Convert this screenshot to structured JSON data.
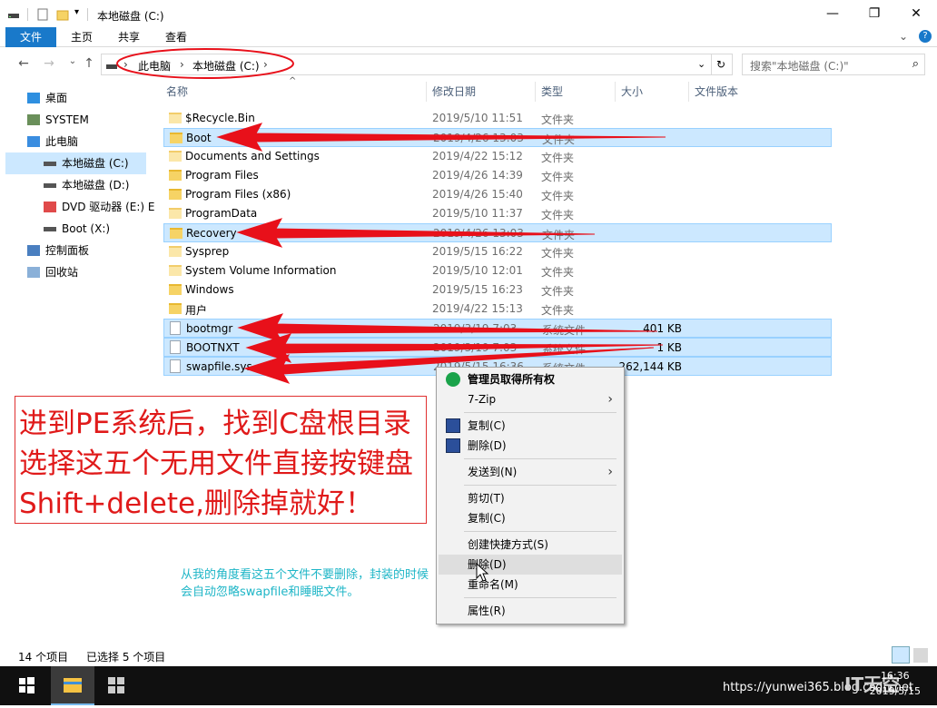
{
  "window": {
    "title": "本地磁盘 (C:)",
    "controls": {
      "minimize": "—",
      "maximize": "❐",
      "close": "✕"
    }
  },
  "ribbon": {
    "tabs": [
      "文件",
      "主页",
      "共享",
      "查看"
    ]
  },
  "address": {
    "path": [
      "此电脑",
      "本地磁盘 (C:)"
    ],
    "search_placeholder": "搜索\"本地磁盘 (C:)\""
  },
  "nav": {
    "items": [
      {
        "label": "桌面",
        "icon": "desktop-icon"
      },
      {
        "label": "SYSTEM",
        "icon": "user-icon"
      },
      {
        "label": "此电脑",
        "icon": "computer-icon"
      },
      {
        "label": "本地磁盘 (C:)",
        "icon": "drive-icon",
        "selected": true
      },
      {
        "label": "本地磁盘 (D:)",
        "icon": "drive-icon"
      },
      {
        "label": "DVD 驱动器 (E:) E",
        "icon": "dvd-icon"
      },
      {
        "label": "Boot (X:)",
        "icon": "drive-icon"
      },
      {
        "label": "控制面板",
        "icon": "control-panel-icon"
      },
      {
        "label": "回收站",
        "icon": "recycle-bin-icon"
      }
    ]
  },
  "columns": {
    "name": "名称",
    "date": "修改日期",
    "type": "类型",
    "size": "大小",
    "version": "文件版本"
  },
  "files": [
    {
      "name": "$Recycle.Bin",
      "date": "2019/5/10 11:51",
      "type": "文件夹",
      "size": "",
      "kind": "folder-light",
      "selected": false
    },
    {
      "name": "Boot",
      "date": "2019/4/26 13:03",
      "type": "文件夹",
      "size": "",
      "kind": "folder",
      "selected": true
    },
    {
      "name": "Documents and Settings",
      "date": "2019/4/22 15:12",
      "type": "文件夹",
      "size": "",
      "kind": "folder-light",
      "selected": false
    },
    {
      "name": "Program Files",
      "date": "2019/4/26 14:39",
      "type": "文件夹",
      "size": "",
      "kind": "folder",
      "selected": false
    },
    {
      "name": "Program Files (x86)",
      "date": "2019/4/26 15:40",
      "type": "文件夹",
      "size": "",
      "kind": "folder",
      "selected": false
    },
    {
      "name": "ProgramData",
      "date": "2019/5/10 11:37",
      "type": "文件夹",
      "size": "",
      "kind": "folder-light",
      "selected": false
    },
    {
      "name": "Recovery",
      "date": "2019/4/26 13:03",
      "type": "文件夹",
      "size": "",
      "kind": "folder",
      "selected": true
    },
    {
      "name": "Sysprep",
      "date": "2019/5/15 16:22",
      "type": "文件夹",
      "size": "",
      "kind": "folder-light",
      "selected": false
    },
    {
      "name": "System Volume Information",
      "date": "2019/5/10 12:01",
      "type": "文件夹",
      "size": "",
      "kind": "folder-light",
      "selected": false
    },
    {
      "name": "Windows",
      "date": "2019/5/15 16:23",
      "type": "文件夹",
      "size": "",
      "kind": "folder",
      "selected": false
    },
    {
      "name": "用户",
      "date": "2019/4/22 15:13",
      "type": "文件夹",
      "size": "",
      "kind": "folder",
      "selected": false
    },
    {
      "name": "bootmgr",
      "date": "2019/3/19 7:03",
      "type": "系统文件",
      "size": "401 KB",
      "kind": "file",
      "selected": true
    },
    {
      "name": "BOOTNXT",
      "date": "2019/3/19 7:03",
      "type": "系统文件",
      "size": "1 KB",
      "kind": "file",
      "selected": true
    },
    {
      "name": "swapfile.sys",
      "date": "2019/5/15 16:36",
      "type": "系统文件",
      "size": "262,144 KB",
      "kind": "file",
      "selected": true
    }
  ],
  "context_menu": {
    "items": [
      {
        "label": "管理员取得所有权",
        "bold": true,
        "icon": "shield-icon"
      },
      {
        "label": "7-Zip",
        "submenu": true
      },
      {
        "sep": true
      },
      {
        "label": "复制(C)",
        "icon": "fc-icon"
      },
      {
        "label": "删除(D)",
        "icon": "fc-icon"
      },
      {
        "sep": true
      },
      {
        "label": "发送到(N)",
        "submenu": true
      },
      {
        "sep": true
      },
      {
        "label": "剪切(T)"
      },
      {
        "label": "复制(C)"
      },
      {
        "sep": true
      },
      {
        "label": "创建快捷方式(S)"
      },
      {
        "label": "删除(D)",
        "hover": true
      },
      {
        "label": "重命名(M)"
      },
      {
        "sep": true
      },
      {
        "label": "属性(R)"
      }
    ]
  },
  "annotation": {
    "lines": [
      "进到PE系统后，找到C盘根目录",
      "选择这五个无用文件直接按键盘",
      "Shift+delete,删除掉就好！"
    ],
    "note_lines": [
      "从我的角度看这五个文件不要删除，封装的时候",
      "会自动忽略swapfile和睡眠文件。"
    ]
  },
  "status": {
    "count": "14 个项目",
    "selected": "已选择 5 个项目"
  },
  "taskbar": {
    "clock_time": "16:36",
    "clock_date": "2019/5/15",
    "watermark": "https://yunwei365.blog.csdn.net",
    "tray_text": "IT天空"
  },
  "colors": {
    "accent": "#1979ca",
    "selection": "#cce8ff",
    "annotation_red": "#e01a1a",
    "note_cyan": "#1fb6c7",
    "arrow_red": "#e8101a"
  }
}
